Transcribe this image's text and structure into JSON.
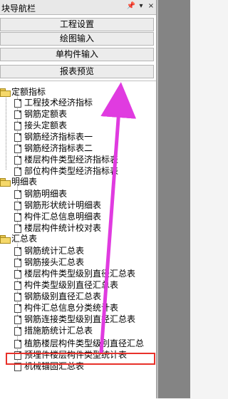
{
  "panel": {
    "title": "块导航栏",
    "pin_glyph": "📌",
    "down_glyph": "▾",
    "close_glyph": "×"
  },
  "buttons": [
    "工程设置",
    "绘图输入",
    "单构件输入",
    "报表预览"
  ],
  "tree": {
    "groups": [
      {
        "label": "定额指标",
        "items": [
          "工程技术经济指标",
          "钢筋定额表",
          "接头定额表",
          "钢筋经济指标表一",
          "钢筋经济指标表二",
          "楼层构件类型经济指标表",
          "部位构件类型经济指标表"
        ]
      },
      {
        "label": "明细表",
        "items": [
          "钢筋明细表",
          "钢筋形状统计明细表",
          "构件汇总信息明细表",
          "楼层构件统计校对表"
        ]
      },
      {
        "label": "汇总表",
        "items": [
          "钢筋统计汇总表",
          "钢筋接头汇总表",
          "楼层构件类型级别直径汇总表",
          "构件类型级别直径汇总表",
          "钢筋级别直径汇总表",
          "构件汇总信息分类统计表",
          "钢筋连接类型级别直径汇总表",
          "措施筋统计汇总表",
          "植筋楼层构件类型级别直径汇总",
          "预埋件楼层构件类型统计表",
          "机械锚固汇总表"
        ]
      }
    ]
  },
  "selected_item": "植筋楼层构件类型级别直径汇总",
  "colors": {
    "highlight": "#e8312a",
    "arrow": "#e03be0",
    "folder": "#f5d86a"
  }
}
